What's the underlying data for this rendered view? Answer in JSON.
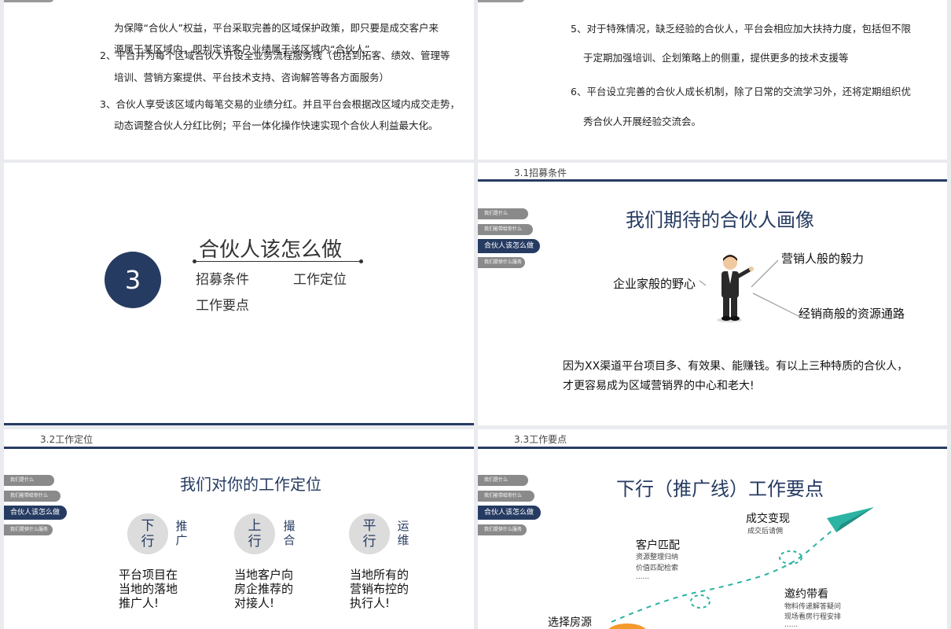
{
  "slide_policy": {
    "p1_line1": "为保障“合伙人”权益，平台采取完善的区域保护政策，即只要是成交客户来",
    "p1_line2": "源属于某区域内，即判定该客户业绩属于该区域内“合伙人”",
    "p2_line1": "2、平台并为每个区域合伙人开设全业务流程服务线（包括到拓客、绩效、管理等",
    "p2_line2": "培训、营销方案提供、平台技术支持、咨询解答等各方面服务）",
    "p3_line1": "3、合伙人享受该区域内每笔交易的业绩分红。并且平台会根据改区域内成交走势，",
    "p3_line2": "动态调整合伙人分红比例；平台一体化操作快速实现个合伙人利益最大化。"
  },
  "slide_support": {
    "p5_line1": "5、对于特殊情况，缺乏经验的合伙人，平台会相应加大扶持力度，包括但不限",
    "p5_line2": "于定期加强培训、企划策略上的侧重，提供更多的技术支援等",
    "p6_line1": "6、平台设立完善的合伙人成长机制，除了日常的交流学习外，还将定期组织优",
    "p6_line2": "秀合伙人开展经验交流会。"
  },
  "slide_section": {
    "number": "3",
    "title": "合伙人该怎么做",
    "items": [
      "招募条件",
      "工作定位",
      "工作要点"
    ]
  },
  "nav": {
    "items": [
      "我们是什么",
      "我们能带给你什么",
      "合伙人该怎么做",
      "我们提供什么服务"
    ]
  },
  "slide_recruit": {
    "section_label": "3.1招募条件",
    "title": "我们期待的合伙人画像",
    "trait_left": "企业家般的野心",
    "trait_top": "营销人般的毅力",
    "trait_bottom": "经销商般的资源通路",
    "summary_line1": "因为XX渠道平台项目多、有效果、能赚钱。有以上三种特质的合伙人，",
    "summary_line2": "才更容易成为区域营销界的中心和老大!"
  },
  "slide_position": {
    "section_label": "3.2工作定位",
    "title": "我们对你的工作定位",
    "roles": [
      {
        "circle": "下\n行",
        "side": "推\n广",
        "desc": "平台项目在\n当地的落地\n推广人!"
      },
      {
        "circle": "上\n行",
        "side": "撮\n合",
        "desc": "当地客户向\n房企推荐的\n对接人!"
      },
      {
        "circle": "平\n行",
        "side": "运\n维",
        "desc": "当地所有的\n营销布控的\n执行人!"
      }
    ]
  },
  "slide_points": {
    "section_label": "3.3工作要点",
    "title": "下行（推广线）工作要点",
    "step_close_title": "成交变现",
    "step_close_sub": "成交后请佣",
    "step_match_title": "客户匹配",
    "step_match_sub1": "资源整理归纳",
    "step_match_sub2": "价值匹配检索",
    "step_match_sub3": "......",
    "step_invite_title": "邀约带看",
    "step_invite_sub1": "物料传递解答疑问",
    "step_invite_sub2": "现场看房行程安排",
    "step_invite_sub3": "......",
    "step_select_title": "选择房源"
  },
  "colors": {
    "navy": "#263b62",
    "gray_pill": "#8a8a8a",
    "teal": "#2bb3a3",
    "orange": "#f39a2b"
  }
}
